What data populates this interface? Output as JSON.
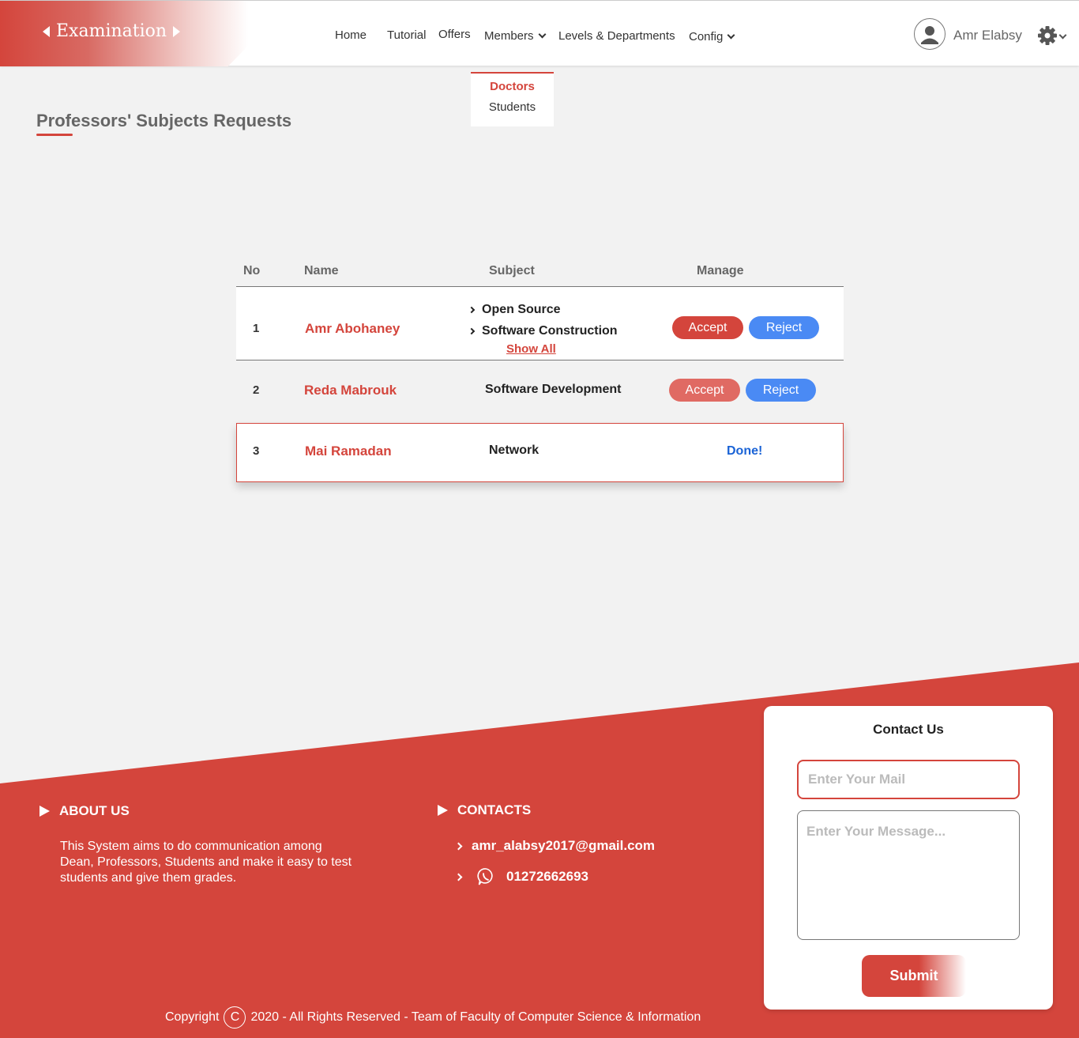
{
  "brand": {
    "name": "Examination"
  },
  "nav": {
    "home": "Home",
    "tutorial": "Tutorial",
    "offers": "Offers",
    "members": "Members",
    "levels": "Levels & Departments",
    "config": "Config"
  },
  "user": {
    "name": "Amr Elabsy"
  },
  "members_dropdown": {
    "items": [
      "Doctors",
      "Students"
    ]
  },
  "page": {
    "title": "Professors' Subjects Requests"
  },
  "table": {
    "headers": [
      "No",
      "Name",
      "Subject",
      "Manage"
    ],
    "rows": [
      {
        "no": "1",
        "name": "Amr Abohaney",
        "subjects": [
          "Open Source",
          "Software Construction"
        ],
        "show_all": "Show All",
        "accept": "Accept",
        "reject": "Reject"
      },
      {
        "no": "2",
        "name": "Reda Mabrouk",
        "subject": "Software Development",
        "accept": "Accept",
        "reject": "Reject"
      },
      {
        "no": "3",
        "name": "Mai Ramadan",
        "subject": "Network",
        "status": "Done!"
      }
    ]
  },
  "footer": {
    "about_title": "ABOUT US",
    "about_text": "This System aims to do communication among Dean, Professors, Students and make it easy to test students and give them grades.",
    "contacts_title": "CONTACTS",
    "email": "amr_alabsy2017@gmail.com",
    "phone": "01272662693",
    "copyright_prefix": "Copyright",
    "copyright_symbol": "C",
    "copyright_text": "2020 - All Rights Reserved - Team of Faculty of Computer Science & Information"
  },
  "contact_form": {
    "title": "Contact Us",
    "mail_placeholder": "Enter Your Mail",
    "message_placeholder": "Enter Your Message...",
    "submit": "Submit"
  },
  "colors": {
    "accent": "#d4453c",
    "reject": "#4a8af4",
    "done": "#1a63d6"
  }
}
